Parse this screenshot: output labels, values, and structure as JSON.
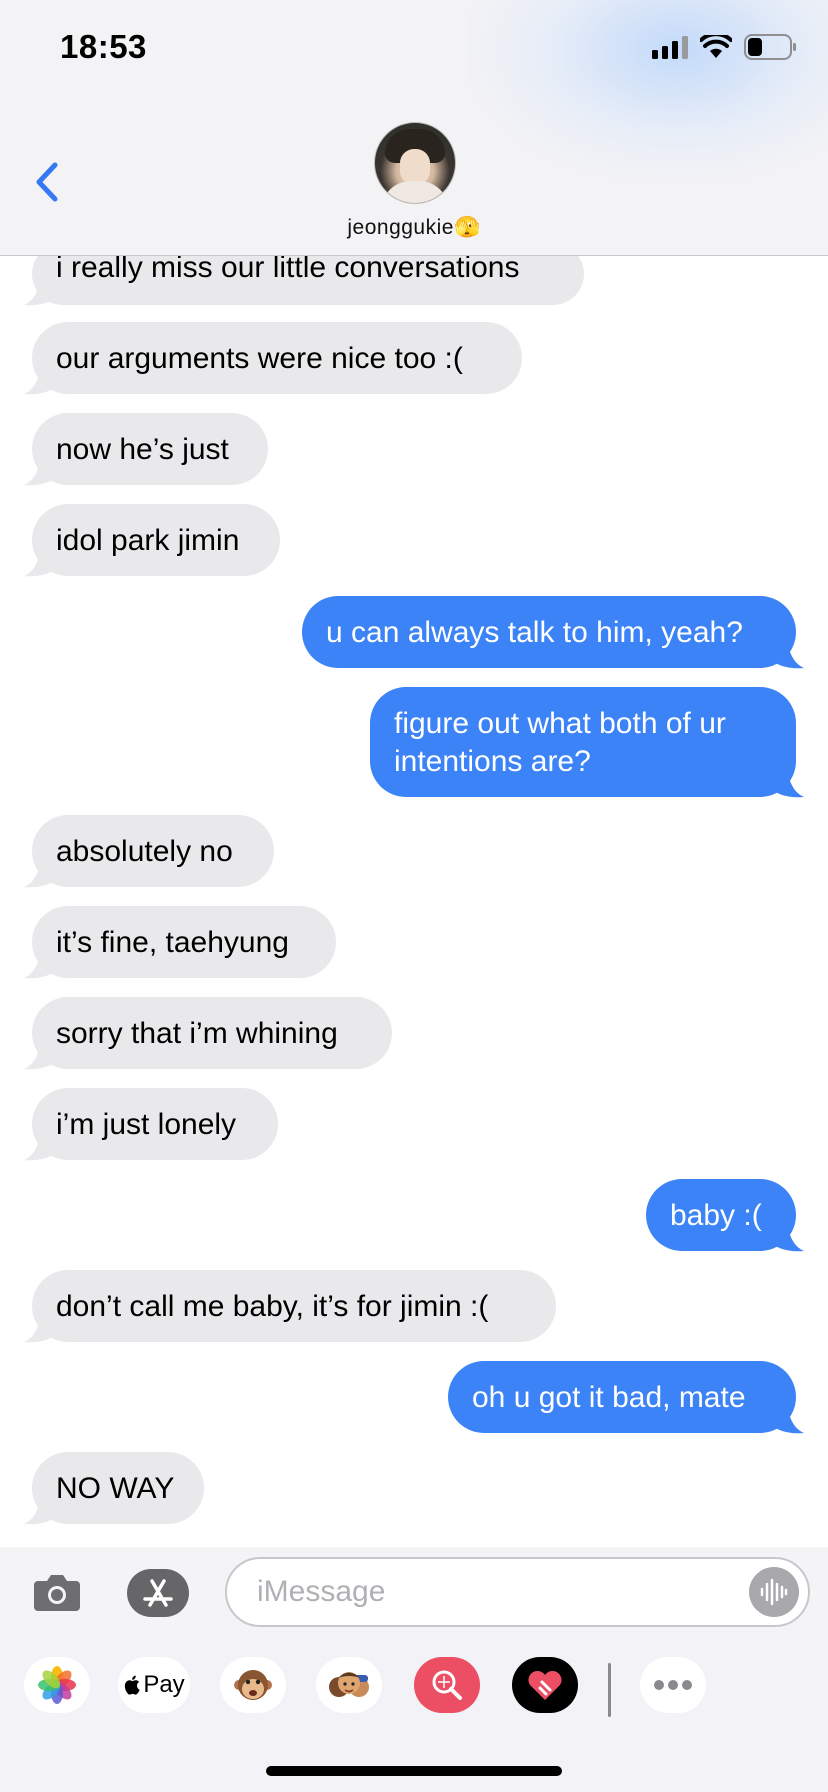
{
  "status_bar": {
    "time": "18:53"
  },
  "header": {
    "contact_name": "jeonggukie🫣",
    "back_icon": "chevron-left-icon",
    "avatar_icon": "contact-avatar"
  },
  "messages": [
    {
      "from": "them",
      "text": "i really miss our little conversations"
    },
    {
      "from": "them",
      "text": "our arguments were nice too :("
    },
    {
      "from": "them",
      "text": "now he’s just"
    },
    {
      "from": "them",
      "text": "idol park jimin"
    },
    {
      "from": "me",
      "text": "u can always talk to him, yeah?"
    },
    {
      "from": "me",
      "text_line1": "figure out what both of ur",
      "text_line2": "intentions are?"
    },
    {
      "from": "them",
      "text": "absolutely no"
    },
    {
      "from": "them",
      "text": "it’s fine, taehyung"
    },
    {
      "from": "them",
      "text": "sorry that i’m whining"
    },
    {
      "from": "them",
      "text": "i’m just lonely"
    },
    {
      "from": "me",
      "text": "baby :("
    },
    {
      "from": "them",
      "text": "don’t call me baby, it’s for jimin :("
    },
    {
      "from": "me",
      "text": "oh u got it bad, mate"
    },
    {
      "from": "them",
      "text": "NO WAY"
    }
  ],
  "composer": {
    "placeholder": "iMessage"
  },
  "app_drawer": {
    "apple_pay_label": "Pay",
    "items": [
      "photos-icon",
      "apple-pay-icon",
      "animoji-icon",
      "memoji-icon",
      "image-search-icon",
      "digital-touch-icon",
      "more-icon"
    ]
  },
  "colors": {
    "sent_bubble": "#3b83f6",
    "received_bubble": "#e9e9eb",
    "accent": "#3478f6"
  }
}
